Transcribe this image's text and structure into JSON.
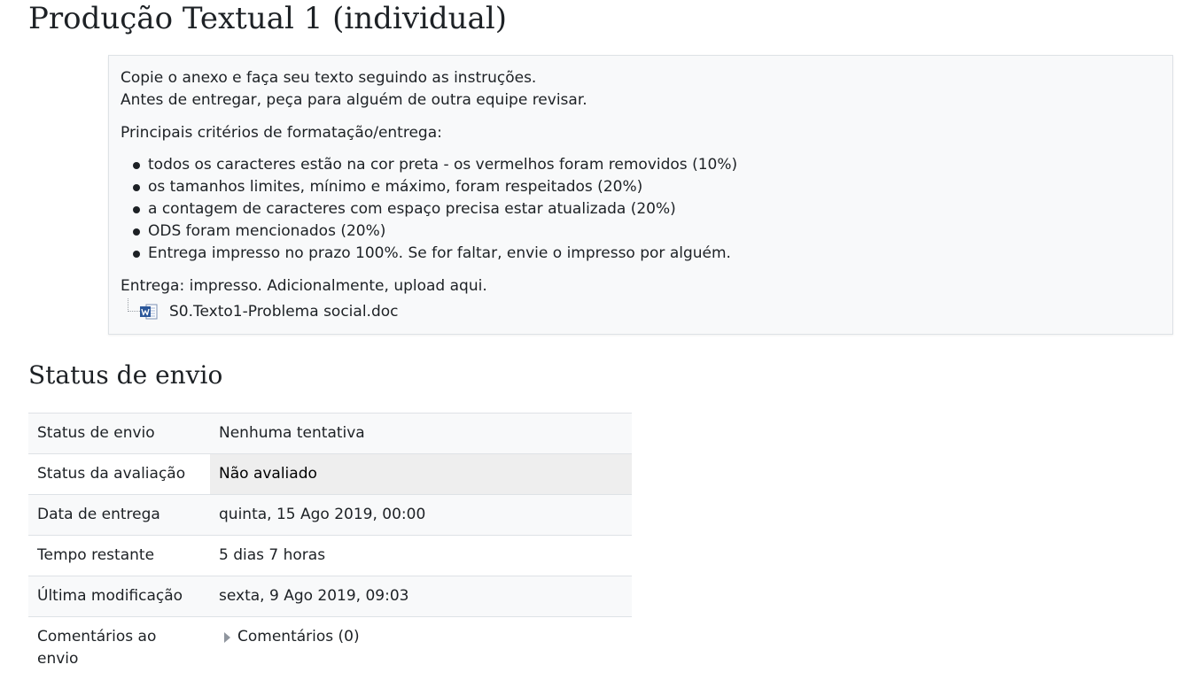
{
  "page": {
    "title": "Produção Textual 1 (individual)"
  },
  "intro": {
    "line1": "Copie o anexo e faça seu texto seguindo as instruções.",
    "line2": "Antes de entregar, peça para alguém de outra equipe revisar.",
    "criteria_heading": "Principais critérios de formatação/entrega:",
    "criteria": [
      "todos os caracteres estão na cor preta - os vermelhos foram removidos (10%)",
      "os tamanhos limites, mínimo e máximo, foram respeitados (20%)",
      "a contagem de caracteres com espaço precisa estar atualizada (20%)",
      "ODS foram mencionados (20%)",
      "Entrega impresso no prazo  100%. Se for faltar, envie o impresso por alguém."
    ],
    "delivery": "Entrega: impresso. Adicionalmente, upload aqui.",
    "attachment": {
      "filename": "S0.Texto1-Problema social.doc",
      "icon": "word-document-icon",
      "icon_color": "#2b579a"
    }
  },
  "submission": {
    "heading": "Status de envio",
    "rows": [
      {
        "label": "Status de envio",
        "value": "Nenhuma tentativa"
      },
      {
        "label": "Status da avaliação",
        "value": "Não avaliado"
      },
      {
        "label": "Data de entrega",
        "value": "quinta, 15 Ago 2019, 00:00"
      },
      {
        "label": "Tempo restante",
        "value": "5 dias 7 horas"
      },
      {
        "label": "Última modificação",
        "value": "sexta, 9 Ago 2019, 09:03"
      },
      {
        "label": "Comentários ao envio",
        "value": "Comentários (0)"
      }
    ]
  }
}
